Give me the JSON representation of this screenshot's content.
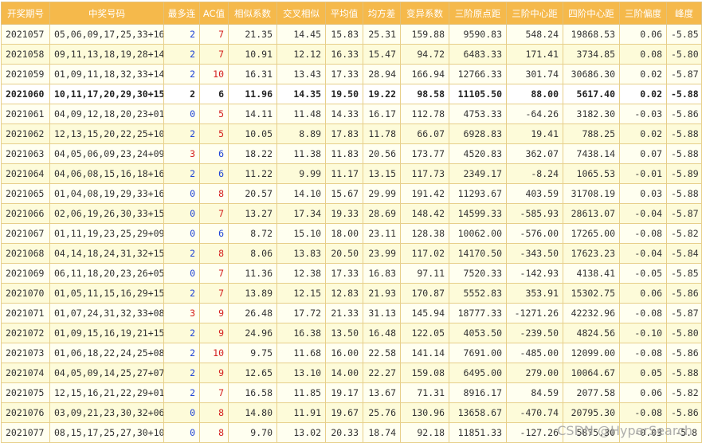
{
  "headers": [
    "开奖期号",
    "中奖号码",
    "最多连",
    "AC值",
    "相似系数",
    "交叉相似",
    "平均值",
    "均方差",
    "变异系数",
    "三阶原点距",
    "三阶中心距",
    "四阶中心距",
    "三阶偏度",
    "峰度"
  ],
  "highlight_row": 3,
  "rows": [
    [
      "2021057",
      "05,06,09,17,25,33+16",
      "2",
      "7",
      "21.35",
      "14.45",
      "15.83",
      "25.31",
      "159.88",
      "9590.83",
      "548.24",
      "19868.53",
      "0.06",
      "-5.85"
    ],
    [
      "2021058",
      "09,11,13,18,19,28+14",
      "2",
      "7",
      "10.91",
      "12.12",
      "16.33",
      "15.47",
      "94.72",
      "6483.33",
      "171.41",
      "3734.85",
      "0.08",
      "-5.80"
    ],
    [
      "2021059",
      "01,09,11,18,32,33+14",
      "2",
      "10",
      "16.31",
      "13.43",
      "17.33",
      "28.94",
      "166.94",
      "12766.33",
      "301.74",
      "30686.30",
      "0.02",
      "-5.87"
    ],
    [
      "2021060",
      "10,11,17,20,29,30+15",
      "2",
      "6",
      "11.96",
      "14.35",
      "19.50",
      "19.22",
      "98.58",
      "11105.50",
      "88.00",
      "5617.40",
      "0.02",
      "-5.88"
    ],
    [
      "2021061",
      "04,09,12,18,20,23+01",
      "0",
      "5",
      "14.11",
      "11.48",
      "14.33",
      "16.17",
      "112.78",
      "4753.33",
      "-64.26",
      "3182.30",
      "-0.03",
      "-5.86"
    ],
    [
      "2021062",
      "12,13,15,20,22,25+10",
      "2",
      "5",
      "10.05",
      "8.89",
      "17.83",
      "11.78",
      "66.07",
      "6928.83",
      "19.41",
      "788.25",
      "0.02",
      "-5.88"
    ],
    [
      "2021063",
      "04,05,06,09,23,24+09",
      "3",
      "6",
      "18.22",
      "11.38",
      "11.83",
      "20.56",
      "173.77",
      "4520.83",
      "362.07",
      "7438.14",
      "0.07",
      "-5.88"
    ],
    [
      "2021064",
      "04,06,08,15,16,18+16",
      "2",
      "6",
      "11.22",
      "9.99",
      "11.17",
      "13.15",
      "117.73",
      "2349.17",
      "-8.24",
      "1065.53",
      "-0.01",
      "-5.89"
    ],
    [
      "2021065",
      "01,04,08,19,29,33+16",
      "0",
      "8",
      "20.57",
      "14.10",
      "15.67",
      "29.99",
      "191.42",
      "11293.67",
      "403.59",
      "31708.19",
      "0.03",
      "-5.88"
    ],
    [
      "2021066",
      "02,06,19,26,30,33+15",
      "0",
      "7",
      "13.27",
      "17.34",
      "19.33",
      "28.69",
      "148.42",
      "14599.33",
      "-585.93",
      "28613.07",
      "-0.04",
      "-5.87"
    ],
    [
      "2021067",
      "01,11,19,23,25,29+09",
      "0",
      "6",
      "8.72",
      "15.10",
      "18.00",
      "23.11",
      "128.38",
      "10062.00",
      "-576.00",
      "17265.00",
      "-0.08",
      "-5.82"
    ],
    [
      "2021068",
      "04,14,18,24,31,32+15",
      "2",
      "8",
      "8.06",
      "13.83",
      "20.50",
      "23.99",
      "117.02",
      "14170.50",
      "-343.50",
      "17623.23",
      "-0.04",
      "-5.84"
    ],
    [
      "2021069",
      "06,11,18,20,23,26+05",
      "0",
      "7",
      "11.36",
      "12.38",
      "17.33",
      "16.83",
      "97.11",
      "7520.33",
      "-142.93",
      "4138.41",
      "-0.05",
      "-5.85"
    ],
    [
      "2021070",
      "01,05,11,15,16,29+15",
      "2",
      "7",
      "13.89",
      "12.15",
      "12.83",
      "21.93",
      "170.87",
      "5552.83",
      "353.91",
      "15302.75",
      "0.06",
      "-5.86"
    ],
    [
      "2021071",
      "01,07,24,31,32,33+08",
      "3",
      "9",
      "26.48",
      "17.72",
      "21.33",
      "31.13",
      "145.94",
      "18777.33",
      "-1271.26",
      "42232.96",
      "-0.08",
      "-5.87"
    ],
    [
      "2021072",
      "01,09,15,16,19,21+15",
      "2",
      "9",
      "24.96",
      "16.38",
      "13.50",
      "16.48",
      "122.05",
      "4053.50",
      "-239.50",
      "4824.56",
      "-0.10",
      "-5.80"
    ],
    [
      "2021073",
      "01,06,18,22,24,25+08",
      "2",
      "10",
      "9.75",
      "11.68",
      "16.00",
      "22.58",
      "141.14",
      "7691.00",
      "-485.00",
      "12099.00",
      "-0.08",
      "-5.86"
    ],
    [
      "2021074",
      "04,05,09,14,25,27+07",
      "2",
      "9",
      "12.65",
      "13.10",
      "14.00",
      "22.27",
      "159.08",
      "6495.00",
      "279.00",
      "10064.67",
      "0.05",
      "-5.88"
    ],
    [
      "2021075",
      "12,15,16,21,22,29+01",
      "2",
      "7",
      "16.58",
      "11.85",
      "19.17",
      "13.67",
      "71.31",
      "8916.17",
      "84.59",
      "2077.58",
      "0.06",
      "-5.82"
    ],
    [
      "2021076",
      "03,09,21,23,30,32+06",
      "0",
      "8",
      "14.80",
      "11.91",
      "19.67",
      "25.76",
      "130.96",
      "13658.67",
      "-470.74",
      "20795.30",
      "-0.08",
      "-5.86"
    ],
    [
      "2021077",
      "08,15,17,25,27,30+10",
      "0",
      "8",
      "9.70",
      "13.02",
      "20.33",
      "18.74",
      "92.18",
      "11851.33",
      "-127.26",
      "5875.30",
      "-0.03",
      "-5.8"
    ]
  ],
  "watermark": "CSDN @HyperSearch",
  "colors": {
    "header_bg": "#f5b94b",
    "row_odd": "#fffff0",
    "row_even": "#fdfbd9",
    "blue": "#1f43d6",
    "red": "#d42020"
  }
}
